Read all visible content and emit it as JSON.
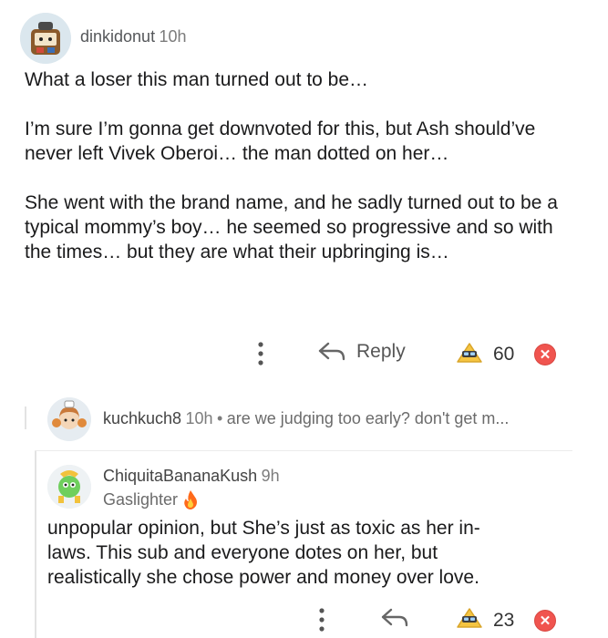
{
  "comment1": {
    "username": "dinkidonut",
    "time": "10h",
    "paragraphs": [
      "What a loser this man turned out to be…",
      "I’m sure I’m gonna get downvoted for this, but Ash should’ve never left Vivek Oberoi… the man dotted on her…",
      "She went with the brand name, and he sadly turned out to be a typical mommy’s boy… he seemed so progressive and so with the times… but they are what their upbringing is…"
    ],
    "actions": {
      "reply_label": "Reply",
      "score": "60"
    }
  },
  "comment2": {
    "username": "kuchkuch8",
    "time": "10h",
    "separator": "•",
    "preview": "are we judging too early? don't get m..."
  },
  "comment3": {
    "username": "ChiquitaBananaKush",
    "time": "9h",
    "flair": "Gaslighter",
    "body": "unpopular opinion, but She’s just as toxic as her in-laws. This sub and everyone dotes on her, but realistically she chose power and money over love.",
    "actions": {
      "score": "23"
    }
  },
  "colors": {
    "downvote": "#f0544f",
    "upvote_gold": "#f5c542"
  }
}
